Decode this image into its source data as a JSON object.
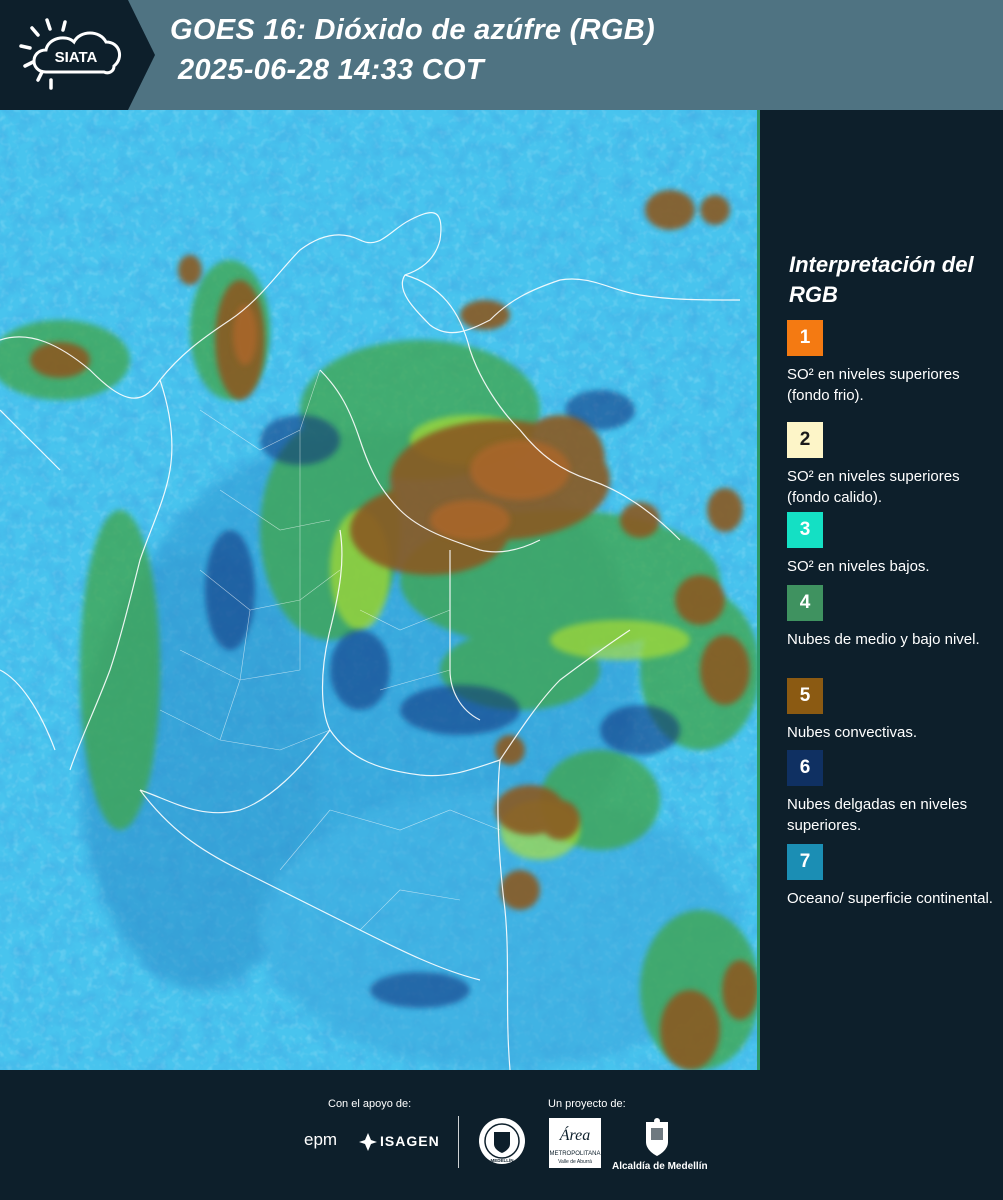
{
  "header": {
    "logo_text": "SIATA",
    "title_line1": "GOES 16: Dióxido de azúfre (RGB)",
    "title_line2": "2025-06-28 14:33 COT"
  },
  "legend": {
    "title": "Interpretación del RGB",
    "items": [
      {
        "number": "1",
        "label": "SO² en niveles superiores (fondo frio).",
        "color": "#f47a12"
      },
      {
        "number": "2",
        "label": "SO² en niveles superiores (fondo calido).",
        "color": "#fdf5c8"
      },
      {
        "number": "3",
        "label": "SO² en niveles bajos.",
        "color": "#14e0c4"
      },
      {
        "number": "4",
        "label": "Nubes de medio y bajo nivel.",
        "color": "#3f9260"
      },
      {
        "number": "5",
        "label": "Nubes convectivas.",
        "color": "#8b5a12"
      },
      {
        "number": "6",
        "label": "Nubes delgadas en niveles superiores.",
        "color": "#0f3062"
      },
      {
        "number": "7",
        "label": "Oceano/ superficie continental.",
        "color": "#1b8eb4"
      }
    ]
  },
  "footer": {
    "support_label": "Con el apoyo de:",
    "project_label": "Un proyecto de:",
    "sponsor_epm": "epm",
    "sponsor_isagen": "ISAGEN",
    "area_metropolitana_title": "Área",
    "area_metropolitana_line1": "METROPOLITANA",
    "area_metropolitana_line2": "Valle de Aburrá",
    "alcaldia": "Alcaldía de Medellín",
    "medellin_seal": "MEDELLÍN"
  },
  "colors": {
    "header_bg": "#4f7382",
    "logo_bg": "#0d1f2b",
    "page_bg": "#0d1f2b",
    "map_ocean": "#48c4ee",
    "map_land": "#3aa9dc",
    "border_lines": "#ffffff"
  }
}
